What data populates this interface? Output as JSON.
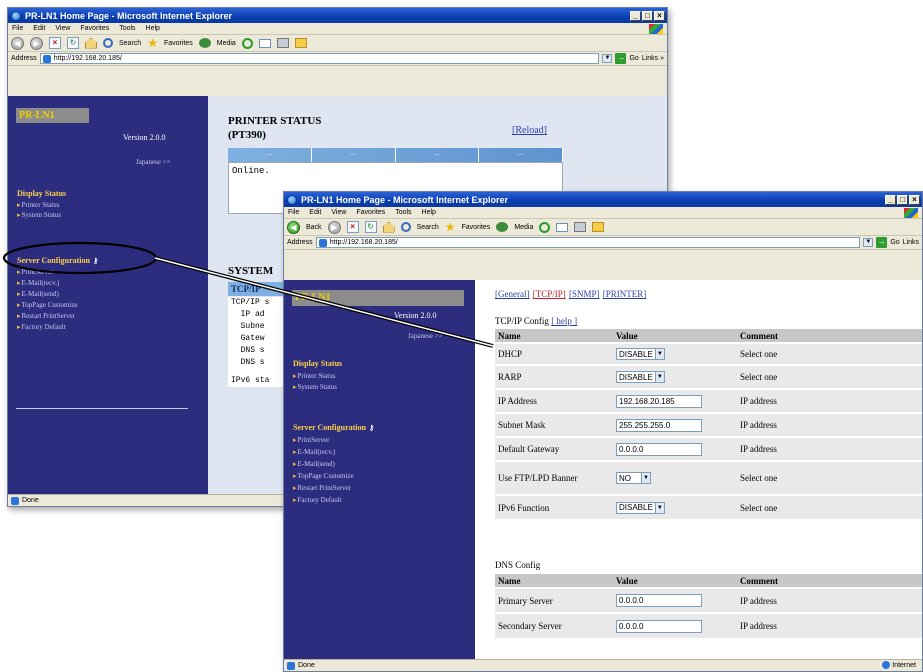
{
  "browser": {
    "title": "PR-LN1 Home Page - Microsoft Internet Explorer",
    "menu": [
      "File",
      "Edit",
      "View",
      "Favorites",
      "Tools",
      "Help"
    ],
    "toolbar": {
      "back": "Back",
      "search": "Search",
      "favorites": "Favorites",
      "media": "Media"
    },
    "address_label": "Address",
    "go_label": "Go",
    "links_label": "Links",
    "status_done": "Done",
    "zone": "Internet",
    "back_window_links": "Links »"
  },
  "back_window": {
    "address": "http://192.168.20.185/",
    "sidebar": {
      "logo": "PR-LN1",
      "version": "Version 2.0.0",
      "japanese": "Japanese >>",
      "display_status": "Display Status",
      "display_links": [
        "Printer Status",
        "System Status"
      ],
      "server_config": "Server Configuration",
      "config_links": [
        "PrintServer",
        "E-Mail(recv.)",
        "E-Mail(send)",
        "TopPage Customize",
        "Restart PrintServer",
        "Factory Default"
      ]
    },
    "main": {
      "title": "PRINTER STATUS",
      "model": "(PT390)",
      "reload": "[Reload]",
      "strip": [
        "---",
        "---",
        "---",
        "---"
      ],
      "status_text": "Online.",
      "system_title": "SYSTEM",
      "tcp_header": "TCP/IP",
      "tcp_lines": [
        "TCP/IP s",
        "  IP ad",
        "  Subne",
        "  Gatew",
        "  DNS s",
        "  DNS s",
        "",
        "IPv6 sta"
      ]
    }
  },
  "front_window": {
    "address": "http://192.168.20.185/",
    "sidebar": {
      "logo": "PR-LN1",
      "version": "Version 2.0.0",
      "japanese": "Japanese >>",
      "display_status": "Display Status",
      "display_links": [
        "Printer Status",
        "System Status"
      ],
      "server_config": "Server Configuration",
      "config_links": [
        "PrintServer",
        "E-Mail(recv.)",
        "E-Mail(send)",
        "TopPage Customize",
        "Restart PrintServer",
        "Factory Default"
      ]
    },
    "nav": [
      "[General]",
      "[TCP/IP]",
      "[SNMP]",
      "[PRINTER]"
    ],
    "tcpip": {
      "title": "TCP/IP Config",
      "help": "[ help ]",
      "headers": [
        "Name",
        "Value",
        "Comment"
      ],
      "rows": [
        {
          "name": "DHCP",
          "value": "DISABLE",
          "kind": "select",
          "comment": "Select one"
        },
        {
          "name": "RARP",
          "value": "DISABLE",
          "kind": "select",
          "comment": "Select one"
        },
        {
          "name": "IP Address",
          "value": "192.168.20.185",
          "kind": "text",
          "comment": "IP address"
        },
        {
          "name": "Subnet Mask",
          "value": "255.255.255.0",
          "kind": "text",
          "comment": "IP address"
        },
        {
          "name": "Default Gateway",
          "value": "0.0.0.0",
          "kind": "text",
          "comment": "IP address"
        },
        {
          "name": "Use FTP/LPD Banner",
          "value": "NO",
          "kind": "select",
          "comment": "Select one"
        },
        {
          "name": "IPv6 Function",
          "value": "DISABLE",
          "kind": "select",
          "comment": "Select one"
        }
      ]
    },
    "dns": {
      "title": "DNS Config",
      "headers": [
        "Name",
        "Value",
        "Comment"
      ],
      "rows": [
        {
          "name": "Primary Server",
          "value": "0.0.0.0",
          "comment": "IP address"
        },
        {
          "name": "Secondary Server",
          "value": "0.0.0.0",
          "comment": "IP address"
        }
      ]
    }
  },
  "colors": {
    "sidebar": "#2d2d7f",
    "heading": "#ffd24a",
    "title_bar": "#0a3dac",
    "active_tab": "#c0202a"
  }
}
